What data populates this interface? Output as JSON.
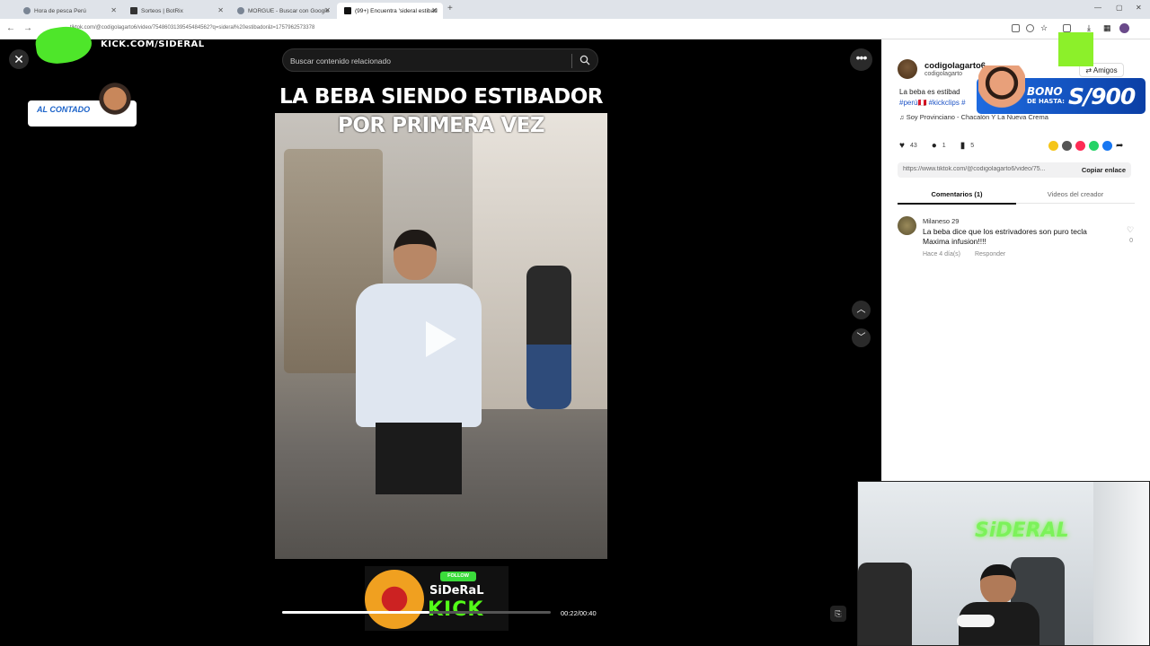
{
  "browser": {
    "tabs": [
      {
        "label": "Hora de pesca Perú"
      },
      {
        "label": "Sorteos | BotRix"
      },
      {
        "label": "MORGUE - Buscar con Google"
      },
      {
        "label": "(99+) Encuentra 'sideral estibad"
      }
    ],
    "url": "tiktok.com/@codigolagarto6/video/7548603139545484562?q=sideral%20estibador&t=1757962573378"
  },
  "overlays": {
    "kick_url": "KICK.COM/SIDERAL",
    "al_contado": "AL CONTADO",
    "bono_line1": "BONO",
    "bono_line2": "DE HASTA:",
    "bono_amount": "S/900"
  },
  "search": {
    "placeholder": "Buscar contenido relacionado"
  },
  "video": {
    "title": "LA BEBA SIENDO ESTIBADOR POR PRIMERA VEZ",
    "current_time": "00:22/00:40",
    "progress": 0.55
  },
  "follow_overlay": {
    "badge": "FOLLOW",
    "name": "SiDeRaL",
    "platform": "KICK"
  },
  "panel": {
    "username": "codigolagarto6",
    "handle": "codigolagarto",
    "friends_button": "Amigos",
    "description": "La beba es estibad",
    "hashtags": "#perú🇵🇪 #kickclips #",
    "music": "Soy Provinciano - Chacalón Y La Nueva Crema",
    "likes": "43",
    "comments_count": "1",
    "saves": "5",
    "link": "https://www.tiktok.com/@codigolagarto6/video/75...",
    "copy_link": "Copiar enlace",
    "tabs": [
      "Comentarios (1)",
      "Videos del creador"
    ],
    "comment": {
      "author": "Milaneso 29",
      "text": "La beba dice que los estrivadores son puro tecla Maxima infusion!!!!",
      "time": "Hace 4 día(s)",
      "reply": "Responder",
      "likes": "0"
    }
  },
  "cam": {
    "neon_text": "SiDERAL"
  },
  "colors": {
    "kick_green": "#53fc18",
    "link_blue": "#2156c7"
  }
}
